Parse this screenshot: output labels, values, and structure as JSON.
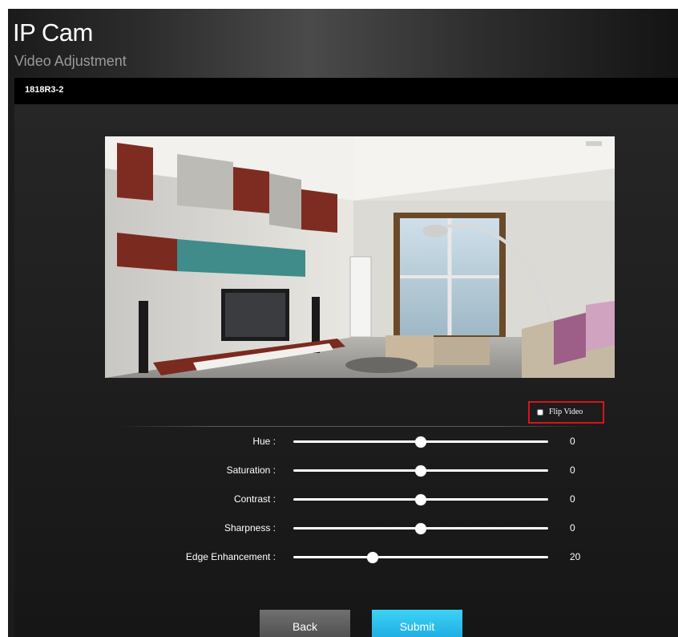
{
  "header": {
    "app_title": "IP Cam",
    "page_subtitle": "Video Adjustment"
  },
  "device": {
    "name": "1818R3-2"
  },
  "video": {
    "preview_alt": "camera-preview-living-room",
    "flip_label": "Flip Video",
    "flip_checked": false
  },
  "sliders": [
    {
      "label": "Hue :",
      "value": "0",
      "position": 0.5
    },
    {
      "label": "Saturation :",
      "value": "0",
      "position": 0.5
    },
    {
      "label": "Contrast :",
      "value": "0",
      "position": 0.5
    },
    {
      "label": "Sharpness :",
      "value": "0",
      "position": 0.5
    },
    {
      "label": "Edge Enhancement :",
      "value": "20",
      "position": 0.31
    }
  ],
  "buttons": {
    "back_label": "Back",
    "submit_label": "Submit"
  },
  "colors": {
    "accent_submit": "#1aa6e0",
    "highlight_border": "#d8141b"
  }
}
